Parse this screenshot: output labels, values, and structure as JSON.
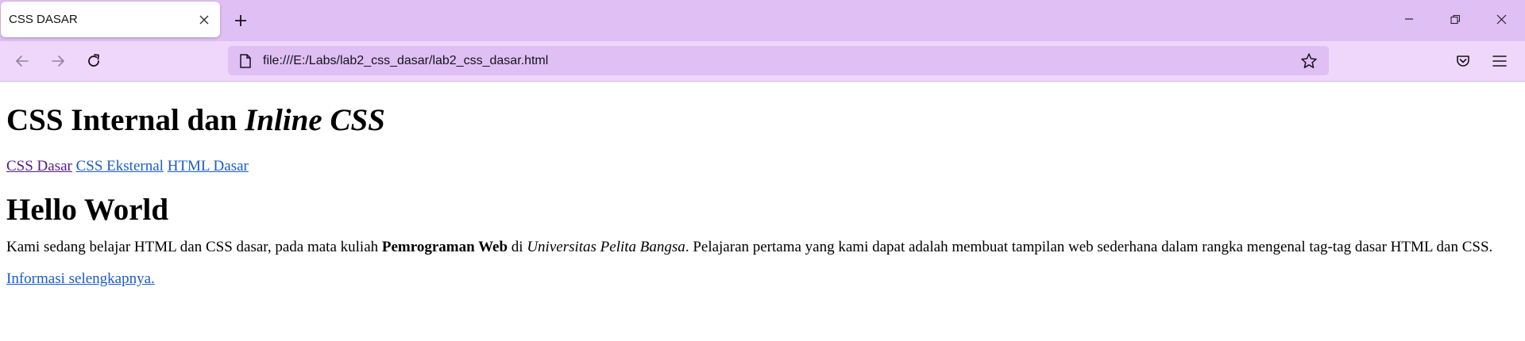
{
  "browser": {
    "tab_title": "CSS DASAR",
    "url": "file:///E:/Labs/lab2_css_dasar/lab2_css_dasar.html",
    "icons": {
      "close_tab": "close-icon",
      "new_tab": "plus-icon",
      "minimize": "minimize-icon",
      "restore": "restore-icon",
      "close_window": "close-icon",
      "back": "back-arrow-icon",
      "forward": "forward-arrow-icon",
      "reload": "reload-icon",
      "page": "page-icon",
      "bookmark": "star-icon",
      "pocket": "pocket-icon",
      "menu": "hamburger-menu-icon"
    },
    "colors": {
      "tabbar": "#e0bff5",
      "navbar": "#efd7fb",
      "urlbar": "#e0bff5"
    }
  },
  "page": {
    "heading_plain": "CSS Internal dan ",
    "heading_italic": "Inline CSS",
    "nav_links": [
      "CSS Dasar",
      "CSS Eksternal",
      "HTML Dasar"
    ],
    "hello_heading": "Hello World",
    "paragraph": {
      "part1": "Kami sedang belajar HTML dan CSS dasar, pada mata kuliah ",
      "bold": "Pemrograman Web",
      "part2": " di ",
      "italic": "Universitas Pelita Bangsa",
      "part3": ". Pelajaran pertama yang kami dapat adalah membuat tampilan web sederhana dalam rangka mengenal tag-tag dasar HTML dan CSS."
    },
    "more_link": "Informasi selengkapnya.",
    "colors": {
      "link": "#1a5ccb",
      "visited_link": "#551a8b"
    }
  }
}
